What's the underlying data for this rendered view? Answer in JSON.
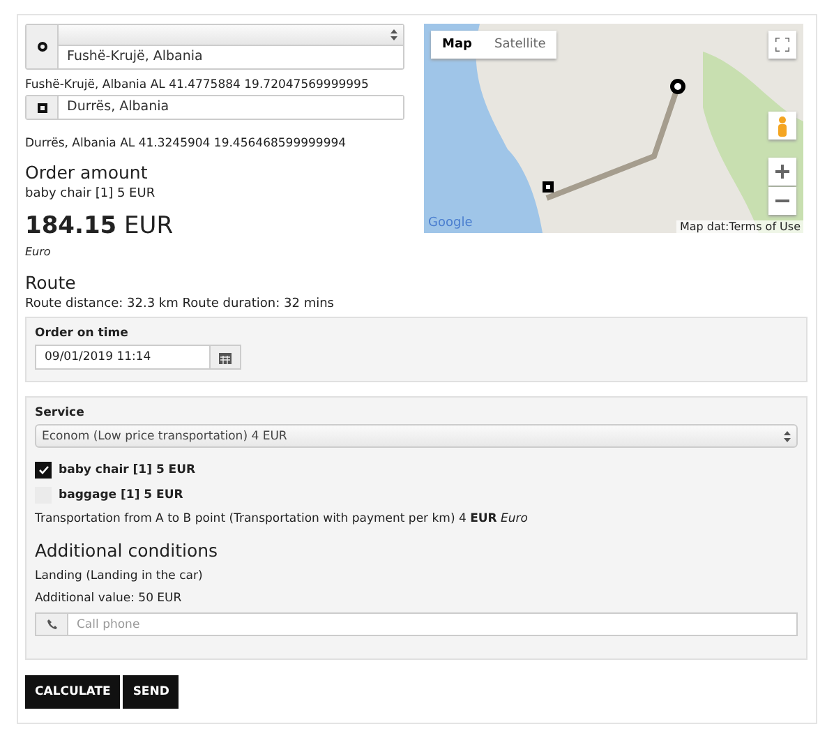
{
  "from": {
    "address": "Fushë-Krujë, Albania",
    "details": "Fushë-Krujë, Albania AL 41.4775884 19.72047569999995"
  },
  "to": {
    "address": "Durrës, Albania",
    "details": "Durrës, Albania AL 41.3245904 19.456468599999994"
  },
  "map": {
    "map_types": [
      {
        "label": "Map",
        "selected": true
      },
      {
        "label": "Satellite",
        "selected": false
      }
    ],
    "logo": "Google",
    "attribution": "Map dat:Terms of Use"
  },
  "order_amount": {
    "heading": "Order amount",
    "items": [
      "baby chair [1] 5 EUR"
    ],
    "total": "**184.15** EUR",
    "currency": "Euro"
  },
  "route": {
    "heading": "Route",
    "info": "Route distance: 32.3 km Route duration: 32 mins"
  },
  "order_time": {
    "label": "Order on time",
    "value": "09/01/2019 11:14"
  },
  "service": {
    "label": "Service",
    "value": "Econom (Low price transportation) 4 EUR",
    "options": [
      {
        "label": "baby chair [1] 5 EUR",
        "checked": true
      },
      {
        "label": "baggage [1] 5 EUR",
        "checked": false
      }
    ],
    "summary": "Transportation from A to B point (Transportation with payment per km) 4  **EUR** *Euro*"
  },
  "additional": {
    "heading": "Additional conditions",
    "lines": [
      "Landing (Landing in the car)",
      "Additional value: 50 EUR"
    ],
    "phone_placeholder": "Call phone"
  },
  "buttons": [
    "CALCULATE",
    "SEND"
  ]
}
